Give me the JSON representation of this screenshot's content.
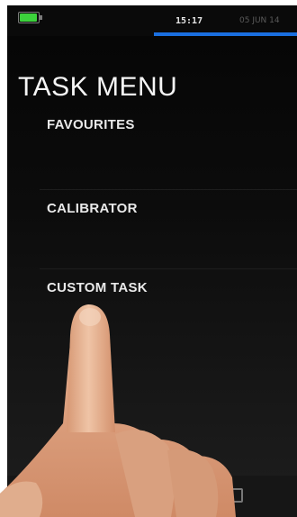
{
  "status_bar": {
    "battery_icon": "battery-icon",
    "battery_color": "#3cd23c",
    "time": "15:17",
    "date": "05 JUN 14",
    "accent_color": "#1a6fe0"
  },
  "page": {
    "title": "TASK MENU"
  },
  "menu": {
    "items": [
      {
        "label": "FAVOURITES"
      },
      {
        "label": "CALIBRATOR"
      },
      {
        "label": "CUSTOM TASK"
      }
    ]
  },
  "nav_bar": {
    "back_icon": "back-arrow-icon",
    "recent_icon": "recent-apps-icon"
  }
}
